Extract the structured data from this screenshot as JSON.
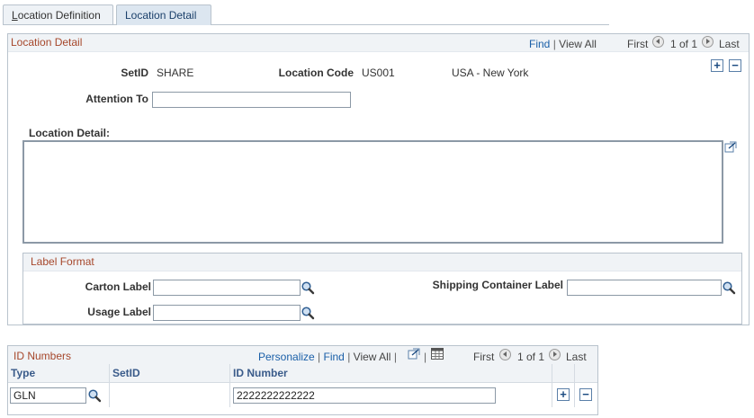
{
  "tabs": [
    {
      "label_first": "L",
      "label_rest": "ocation Definition",
      "active": false
    },
    {
      "label": "Location Detail",
      "active": true
    }
  ],
  "location_detail": {
    "title": "Location Detail",
    "nav": {
      "find": "Find",
      "sep": "|",
      "view_all": "View All",
      "first": "First",
      "range": "1 of 1",
      "last": "Last"
    },
    "setid_label": "SetID",
    "setid_value": "SHARE",
    "location_code_label": "Location Code",
    "location_code_value": "US001",
    "location_desc": "USA - New York",
    "attention_to_label": "Attention To",
    "attention_to_value": "",
    "detail_label": "Location Detail:",
    "detail_value": "",
    "add_btn": "+",
    "remove_btn": "−"
  },
  "label_format": {
    "title": "Label Format",
    "carton_label": "Carton Label",
    "carton_value": "",
    "usage_label": "Usage Label",
    "usage_value": "",
    "shipping_label": "Shipping Container Label",
    "shipping_value": ""
  },
  "id_numbers": {
    "title": "ID Numbers",
    "nav": {
      "personalize": "Personalize",
      "find": "Find",
      "sep": "|",
      "view_all": "View All",
      "first": "First",
      "range": "1 of 1",
      "last": "Last"
    },
    "columns": {
      "type": "Type",
      "setid": "SetID",
      "id_number": "ID Number"
    },
    "rows": [
      {
        "type": "GLN",
        "setid": "",
        "id_number": "2222222222222"
      }
    ],
    "add_btn": "+",
    "remove_btn": "−"
  },
  "icons": {
    "lookup": "magnifier-icon",
    "expand": "expand-textarea-icon",
    "zoom": "zoom-grid-icon",
    "download": "download-grid-icon"
  }
}
